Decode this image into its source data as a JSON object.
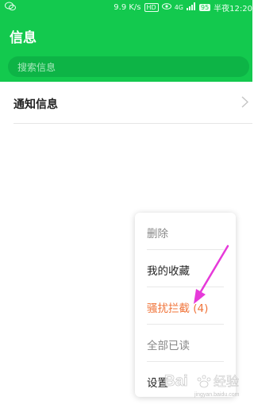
{
  "status_bar": {
    "left_icon": "wechat-icon",
    "speed": "9.9 K/s",
    "hd": "HD",
    "network": "4G",
    "battery": "95",
    "time": "半夜12:20"
  },
  "header": {
    "title": "信息",
    "search_placeholder": "搜索信息",
    "color": "#13c94e"
  },
  "list": {
    "items": [
      {
        "label": "通知信息"
      }
    ]
  },
  "menu": {
    "items": [
      {
        "label": "删除",
        "color": "#888888"
      },
      {
        "label": "我的收藏",
        "color": "#222222"
      },
      {
        "label": "骚扰拦截 (4)",
        "color": "#f0743a"
      },
      {
        "label": "全部已读",
        "color": "#888888"
      },
      {
        "label": "设置",
        "color": "#222222"
      }
    ]
  },
  "annotation": {
    "arrow_color": "#e63ad9"
  },
  "watermark": {
    "text": "Bai 经验",
    "subtext": "jingyan.baidu.com"
  }
}
